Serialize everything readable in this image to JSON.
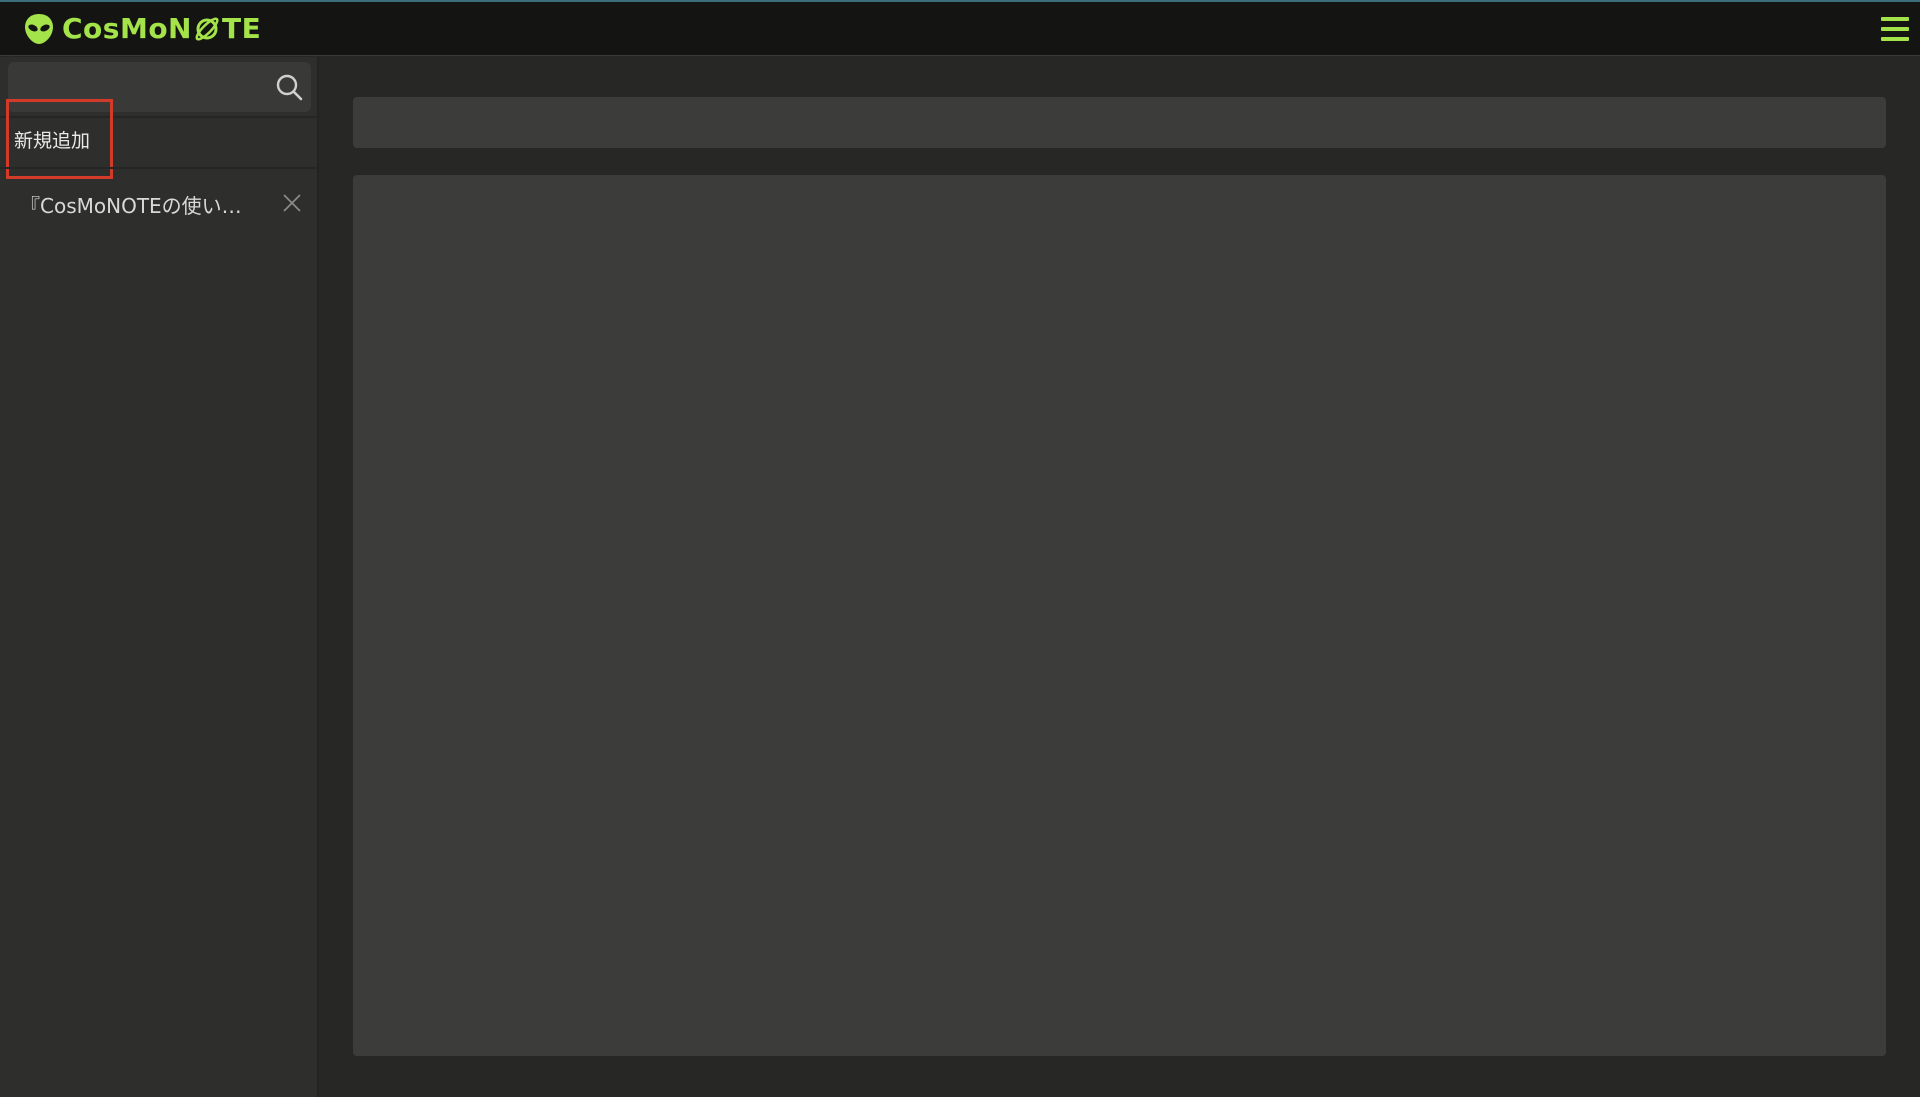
{
  "header": {
    "logo_text_prefix": "CosMoN",
    "logo_text_suffix": "TE",
    "logo_icon": "alien-head-icon",
    "planet_icon": "planet-icon",
    "menu_icon": "hamburger-menu-icon",
    "accent_color": "#a4e34a"
  },
  "sidebar": {
    "search": {
      "value": "",
      "placeholder": "",
      "icon": "search-icon"
    },
    "new_button_label": "新規追加",
    "highlight_color": "#d23a2a",
    "notes": [
      {
        "title": "『CosMoNOTEの使い…",
        "close_icon": "close-icon"
      }
    ]
  },
  "editor": {
    "title_value": "",
    "title_placeholder": "",
    "body_value": "",
    "body_placeholder": ""
  }
}
